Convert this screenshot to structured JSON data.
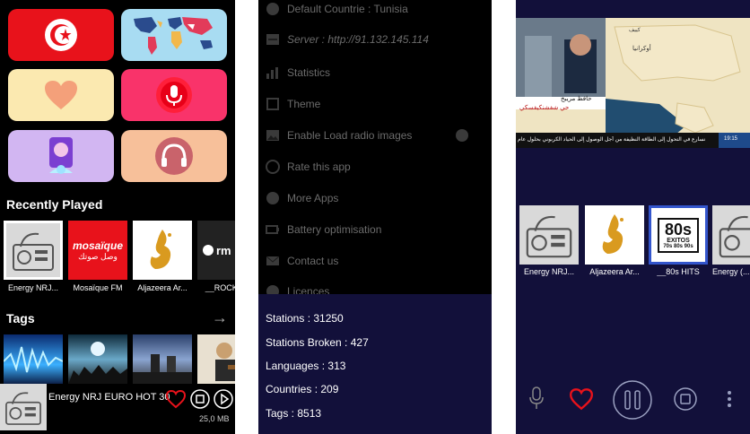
{
  "screen1": {
    "sections": {
      "recently_played": "Recently Played",
      "tags": "Tags"
    },
    "recently_played": [
      {
        "label": "Energy NRJ..."
      },
      {
        "label": "Mosaïque FM"
      },
      {
        "label": "Aljazeera Ar..."
      },
      {
        "label": "__ROCK_..."
      }
    ],
    "mosaique_logo": "mosaïque",
    "mosaique_sub": "وصل صوتك",
    "rm_logo": "rm",
    "now_playing": {
      "title": "Energy NRJ EURO HOT 30",
      "size": "25,0 MB"
    },
    "colors": {
      "tunisia_red": "#e8121b",
      "pink": "#f9336a",
      "yellow": "#fbe9b0",
      "lavender": "#d2b6f2",
      "peach": "#f7c09a",
      "map_blue": "#a8dcf2"
    }
  },
  "screen2": {
    "menu": [
      {
        "label": "Default Countrie : Tunisia",
        "icon": "flag-icon"
      },
      {
        "label": "Server : http://91.132.145.114",
        "icon": "server-icon"
      },
      {
        "label": "Statistics",
        "icon": "chart-icon"
      },
      {
        "label": "Theme",
        "icon": "theme-icon"
      },
      {
        "label": "Enable Load radio images",
        "icon": "image-icon"
      },
      {
        "label": "Rate this app",
        "icon": "rate-icon"
      },
      {
        "label": "More Apps",
        "icon": "apps-icon"
      },
      {
        "label": "Battery optimisation",
        "icon": "battery-icon"
      },
      {
        "label": "Contact us",
        "icon": "mail-icon"
      },
      {
        "label": "Licences",
        "icon": "licence-icon"
      }
    ],
    "stats": [
      {
        "label": "Stations : 31250"
      },
      {
        "label": "Stations Broken : 427"
      },
      {
        "label": "Languages : 313"
      },
      {
        "label": "Countries : 209"
      },
      {
        "label": "Tags : 8513"
      }
    ]
  },
  "screen3": {
    "stations": [
      {
        "label": "Energy NRJ..."
      },
      {
        "label": "Aljazeera Ar..."
      },
      {
        "label": "__80s HITS"
      },
      {
        "label": "Energy (..."
      }
    ],
    "hits80": {
      "big": "80s",
      "line1": "EXITOS",
      "line2": "70s 80s 90s"
    },
    "video": {
      "lower_third_name": "حافظ مريبخ",
      "lower_third_loc": "حي شفشنكيفسكي",
      "ticker": "نسارع في التحول إلى الطاقة النظيفة من أجل الوصول إلى الحياد الكربوني بحلول عام",
      "time": "19:15",
      "map_label_1": "أوكرانيا",
      "map_label_2": "كييف"
    }
  }
}
